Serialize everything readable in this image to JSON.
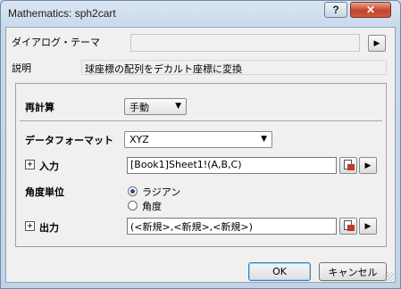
{
  "window": {
    "title": "Mathematics: sph2cart",
    "help_label": "?",
    "close_label": "✕"
  },
  "dialog_theme": {
    "label": "ダイアログ・テーマ",
    "value": "",
    "menu_label": "▶"
  },
  "description": {
    "label": "説明",
    "text": "球座標の配列をデカルト座標に変換"
  },
  "recalculate": {
    "label": "再計算",
    "value": "手動"
  },
  "data_format": {
    "label": "データフォーマット",
    "value": "XYZ"
  },
  "input": {
    "expander": "+",
    "label": "入力",
    "value": "[Book1]Sheet1!(A,B,C)",
    "menu_label": "▶"
  },
  "angle_unit": {
    "label": "角度単位",
    "options": [
      {
        "label": "ラジアン",
        "selected": true
      },
      {
        "label": "角度",
        "selected": false
      }
    ]
  },
  "output": {
    "expander": "+",
    "label": "出力",
    "value": "(<新規>,<新規>,<新規>)",
    "menu_label": "▶"
  },
  "buttons": {
    "ok": "OK",
    "cancel": "キャンセル"
  },
  "icons": {
    "dropdown": "chevron-down-icon",
    "picker": "range-picker-icon"
  }
}
